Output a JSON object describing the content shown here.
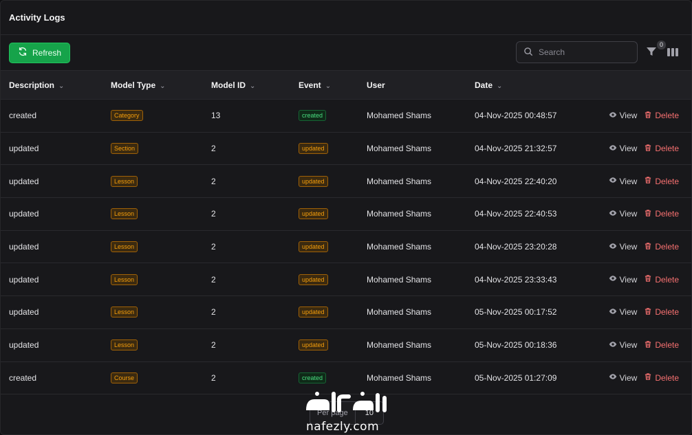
{
  "header": {
    "title": "Activity Logs"
  },
  "toolbar": {
    "refresh_label": "Refresh",
    "search_placeholder": "Search",
    "filter_count": "0"
  },
  "table": {
    "columns": [
      "Description",
      "Model Type",
      "Model ID",
      "Event",
      "User",
      "Date"
    ],
    "view_label": "View",
    "delete_label": "Delete",
    "rows": [
      {
        "description": "created",
        "model_type": "Category",
        "model_id": "13",
        "event": "created",
        "user": "Mohamed Shams",
        "date": "04-Nov-2025 00:48:57"
      },
      {
        "description": "updated",
        "model_type": "Section",
        "model_id": "2",
        "event": "updated",
        "user": "Mohamed Shams",
        "date": "04-Nov-2025 21:32:57"
      },
      {
        "description": "updated",
        "model_type": "Lesson",
        "model_id": "2",
        "event": "updated",
        "user": "Mohamed Shams",
        "date": "04-Nov-2025 22:40:20"
      },
      {
        "description": "updated",
        "model_type": "Lesson",
        "model_id": "2",
        "event": "updated",
        "user": "Mohamed Shams",
        "date": "04-Nov-2025 22:40:53"
      },
      {
        "description": "updated",
        "model_type": "Lesson",
        "model_id": "2",
        "event": "updated",
        "user": "Mohamed Shams",
        "date": "04-Nov-2025 23:20:28"
      },
      {
        "description": "updated",
        "model_type": "Lesson",
        "model_id": "2",
        "event": "updated",
        "user": "Mohamed Shams",
        "date": "04-Nov-2025 23:33:43"
      },
      {
        "description": "updated",
        "model_type": "Lesson",
        "model_id": "2",
        "event": "updated",
        "user": "Mohamed Shams",
        "date": "05-Nov-2025 00:17:52"
      },
      {
        "description": "updated",
        "model_type": "Lesson",
        "model_id": "2",
        "event": "updated",
        "user": "Mohamed Shams",
        "date": "05-Nov-2025 00:18:36"
      },
      {
        "description": "created",
        "model_type": "Course",
        "model_id": "2",
        "event": "created",
        "user": "Mohamed Shams",
        "date": "05-Nov-2025 01:27:09"
      }
    ]
  },
  "pagination": {
    "per_page_label": "Per page",
    "per_page_value": "10"
  },
  "watermark": {
    "text": "nafezly.com",
    "logo_text": "نفذلي"
  },
  "colors": {
    "accent": "#16a34a",
    "badge_amber": "#f59e0b",
    "badge_green": "#4ade80",
    "delete": "#f87171"
  }
}
